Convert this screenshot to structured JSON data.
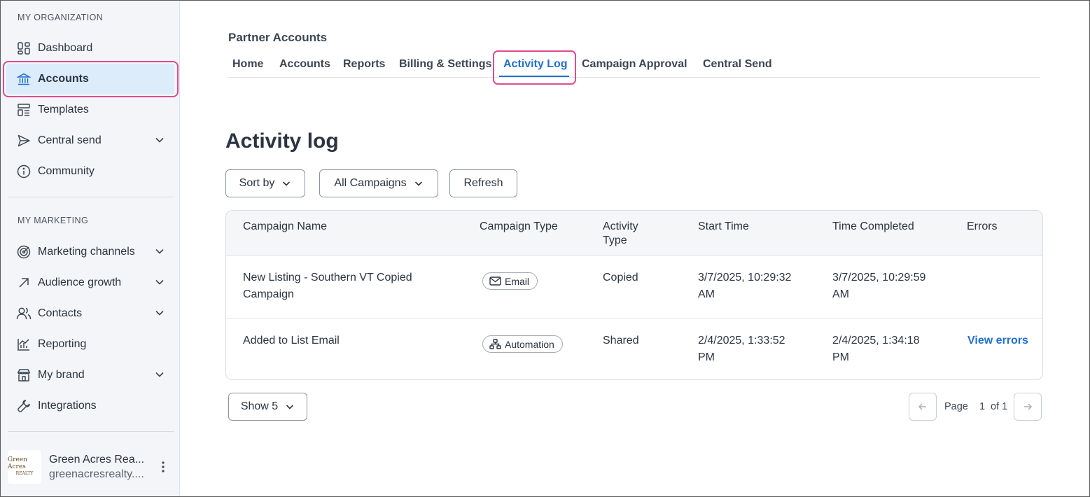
{
  "sidebar": {
    "section_org": "MY ORGANIZATION",
    "section_marketing": "MY MARKETING",
    "org_items": [
      {
        "label": "Dashboard",
        "icon": "dashboard-icon"
      },
      {
        "label": "Accounts",
        "icon": "bank-icon",
        "active": true
      },
      {
        "label": "Templates",
        "icon": "templates-icon"
      },
      {
        "label": "Central send",
        "icon": "send-icon",
        "expandable": true
      },
      {
        "label": "Community",
        "icon": "info-icon"
      }
    ],
    "marketing_items": [
      {
        "label": "Marketing channels",
        "icon": "target-icon",
        "expandable": true
      },
      {
        "label": "Audience growth",
        "icon": "arrow-up-right-icon",
        "expandable": true
      },
      {
        "label": "Contacts",
        "icon": "contacts-icon",
        "expandable": true
      },
      {
        "label": "Reporting",
        "icon": "chart-icon"
      },
      {
        "label": "My brand",
        "icon": "store-icon",
        "expandable": true
      },
      {
        "label": "Integrations",
        "icon": "wrench-icon"
      }
    ],
    "org": {
      "name": "Green Acres Rea...",
      "email": "greenacresrealty....",
      "logo_line1": "Green Acres",
      "logo_line2": "REALTY"
    }
  },
  "header": {
    "title": "Partner Accounts",
    "tabs": [
      "Home",
      "Accounts",
      "Reports",
      "Billing & Settings",
      "Activity Log",
      "Campaign Approval",
      "Central Send"
    ],
    "active_tab": "Activity Log"
  },
  "page": {
    "title": "Activity log",
    "sort_label": "Sort by",
    "filter_label": "All Campaigns",
    "refresh_label": "Refresh"
  },
  "table": {
    "headers": {
      "campaign_name": "Campaign Name",
      "campaign_type": "Campaign Type",
      "activity_type_1": "Activity",
      "activity_type_2": "Type",
      "start_time": "Start Time",
      "time_completed": "Time Completed",
      "errors": "Errors"
    },
    "rows": [
      {
        "name_1": "New Listing - Southern VT Copied",
        "name_2": "Campaign",
        "type": "Email",
        "type_icon": "envelope-icon",
        "activity": "Copied",
        "start_1": "3/7/2025, 10:29:32",
        "start_2": "AM",
        "end_1": "3/7/2025, 10:29:59",
        "end_2": "AM",
        "errors": ""
      },
      {
        "name_1": "Added to List Email",
        "name_2": "",
        "type": "Automation",
        "type_icon": "automation-icon",
        "activity": "Shared",
        "start_1": "2/4/2025, 1:33:52",
        "start_2": "PM",
        "end_1": "2/4/2025, 1:34:18",
        "end_2": "PM",
        "errors": "View errors"
      }
    ]
  },
  "pagination": {
    "show_label": "Show 5",
    "page_label": "Page",
    "page_number": "1",
    "of_label": "of 1"
  },
  "colors": {
    "accent": "#1f6fd1",
    "highlight": "#e04c8c",
    "active_bg": "#dcecfb",
    "sidebar_bg": "#f3f5f8"
  }
}
